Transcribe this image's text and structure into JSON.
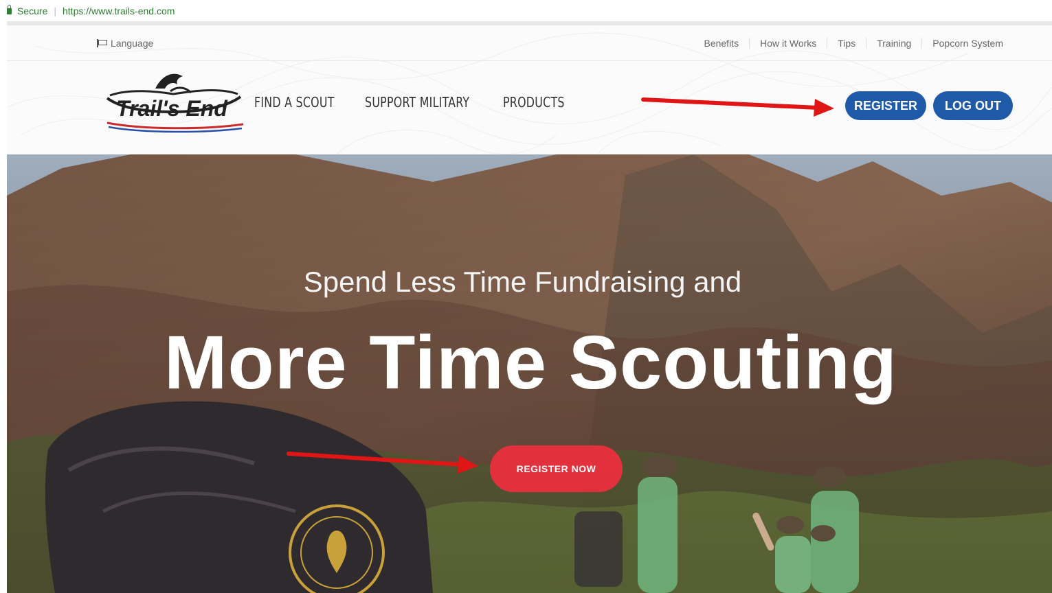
{
  "browser": {
    "secure_label": "Secure",
    "url": "https://www.trails-end.com"
  },
  "header": {
    "language_label": "Language",
    "util_links": [
      "Benefits",
      "How it Works",
      "Tips",
      "Training",
      "Popcorn System"
    ],
    "logo_text": "Trail's End",
    "nav": [
      "FIND A SCOUT",
      "SUPPORT MILITARY",
      "PRODUCTS"
    ],
    "register_label": "REGISTER",
    "logout_label": "LOG OUT"
  },
  "hero": {
    "subtitle": "Spend Less Time Fundraising and",
    "title": "More Time Scouting",
    "cta_label": "REGISTER NOW"
  },
  "colors": {
    "primary_blue": "#1f5aa8",
    "cta_red": "#e2313d",
    "annotation_arrow": "#e01515"
  }
}
